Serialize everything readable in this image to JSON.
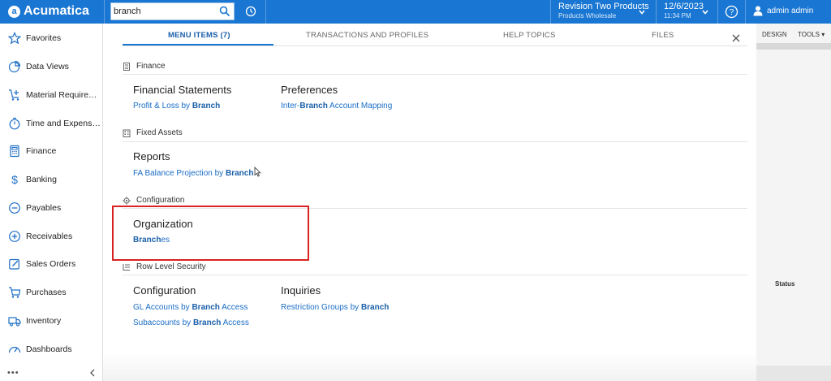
{
  "app": {
    "logo_text": "Acumatica",
    "logo_mark": "a"
  },
  "topbar": {
    "search_value": "branch",
    "company_name": "Revision Two Products",
    "company_branch": "Products Wholesale",
    "date": "12/6/2023",
    "time": "11:34 PM",
    "user_name": "admin admin",
    "accent_color": "#1976d2"
  },
  "sidebar": {
    "items": [
      {
        "label": "Favorites",
        "icon": "star-icon"
      },
      {
        "label": "Data Views",
        "icon": "pie-chart-icon"
      },
      {
        "label": "Material Requireme...",
        "icon": "cart-plus-icon"
      },
      {
        "label": "Time and Expenses",
        "icon": "stopwatch-icon"
      },
      {
        "label": "Finance",
        "icon": "calculator-icon"
      },
      {
        "label": "Banking",
        "icon": "dollar-icon"
      },
      {
        "label": "Payables",
        "icon": "minus-circle-icon"
      },
      {
        "label": "Receivables",
        "icon": "plus-circle-icon"
      },
      {
        "label": "Sales Orders",
        "icon": "edit-icon"
      },
      {
        "label": "Purchases",
        "icon": "cart-icon"
      },
      {
        "label": "Inventory",
        "icon": "truck-icon"
      },
      {
        "label": "Dashboards",
        "icon": "gauge-icon"
      }
    ],
    "more": "•••"
  },
  "right": {
    "design_label": "DESIGN",
    "tools_label": "TOOLS ▾",
    "status_label": "Status"
  },
  "panel": {
    "tabs": [
      {
        "label": "MENU ITEMS  (7)",
        "active": true
      },
      {
        "label": "TRANSACTIONS AND PROFILES",
        "active": false
      },
      {
        "label": "HELP TOPICS",
        "active": false
      },
      {
        "label": "FILES",
        "active": false
      }
    ],
    "sections": {
      "finance": {
        "label": "Finance",
        "icon": "calculator-icon",
        "groups": {
          "financial_statements": {
            "title": "Financial Statements",
            "link_pre": "Profit & Loss by ",
            "link_bold": "Branch",
            "link_post": ""
          },
          "preferences": {
            "title": "Preferences",
            "link_pre": "Inter-",
            "link_bold": "Branch",
            "link_post": " Account Mapping"
          }
        }
      },
      "fixed_assets": {
        "label": "Fixed Assets",
        "icon": "building-icon",
        "groups": {
          "reports": {
            "title": "Reports",
            "link_pre": "FA Balance Projection by ",
            "link_bold": "Branch",
            "link_post": ""
          }
        }
      },
      "configuration": {
        "label": "Configuration",
        "icon": "gear-icon",
        "groups": {
          "organization": {
            "title": "Organization",
            "link_pre": "",
            "link_bold": "Branch",
            "link_post": "es"
          }
        }
      },
      "row_level_security": {
        "label": "Row Level Security",
        "icon": "list-icon",
        "groups": {
          "configuration": {
            "title": "Configuration",
            "links": [
              {
                "pre": "GL Accounts by ",
                "bold": "Branch",
                "post": " Access"
              },
              {
                "pre": "Subaccounts by ",
                "bold": "Branch",
                "post": " Access"
              }
            ]
          },
          "inquiries": {
            "title": "Inquiries",
            "link_pre": "Restriction Groups by ",
            "link_bold": "Branch",
            "link_post": ""
          }
        }
      }
    },
    "highlight_color": "#d92323"
  }
}
